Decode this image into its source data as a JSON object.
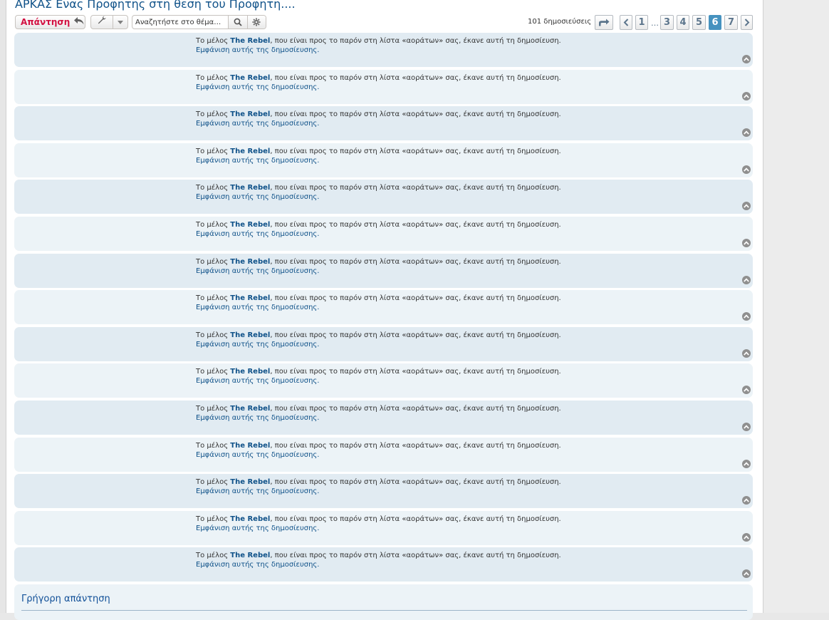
{
  "topic": {
    "title": "ΑΡΚΑΣ Ενας Προφητης στη θεση του Προφητη...."
  },
  "actions": {
    "reply_label": "Απάντηση",
    "reply_icon": "reply-arrow-icon",
    "tools_icon": "wrench-icon",
    "search_placeholder": "Αναζητήστε στο θέμα…",
    "search_icon": "search-icon",
    "advanced_search_icon": "gear-icon"
  },
  "pagination": {
    "post_count": "101 δημοσιεύσεις",
    "pages": [
      "1",
      "3",
      "4",
      "5",
      "6",
      "7"
    ],
    "ellipsis": "…",
    "current_page": "6"
  },
  "posts": [
    {
      "member_prefix": "Το μέλος",
      "member": "The Rebel",
      "member_suffix": ", που είναι προς το παρόν στη λίστα «αοράτων» σας, έκανε αυτή τη δημοσίευση.",
      "show_link": "Εμφάνιση αυτής της δημοσίευσης."
    },
    {
      "member_prefix": "Το μέλος",
      "member": "The Rebel",
      "member_suffix": ", που είναι προς το παρόν στη λίστα «αοράτων» σας, έκανε αυτή τη δημοσίευση.",
      "show_link": "Εμφάνιση αυτής της δημοσίευσης."
    },
    {
      "member_prefix": "Το μέλος",
      "member": "The Rebel",
      "member_suffix": ", που είναι προς το παρόν στη λίστα «αοράτων» σας, έκανε αυτή τη δημοσίευση.",
      "show_link": "Εμφάνιση αυτής της δημοσίευσης."
    },
    {
      "member_prefix": "Το μέλος",
      "member": "The Rebel",
      "member_suffix": ", που είναι προς το παρόν στη λίστα «αοράτων» σας, έκανε αυτή τη δημοσίευση.",
      "show_link": "Εμφάνιση αυτής της δημοσίευσης."
    },
    {
      "member_prefix": "Το μέλος",
      "member": "The Rebel",
      "member_suffix": ", που είναι προς το παρόν στη λίστα «αοράτων» σας, έκανε αυτή τη δημοσίευση.",
      "show_link": "Εμφάνιση αυτής της δημοσίευσης."
    },
    {
      "member_prefix": "Το μέλος",
      "member": "The Rebel",
      "member_suffix": ", που είναι προς το παρόν στη λίστα «αοράτων» σας, έκανε αυτή τη δημοσίευση.",
      "show_link": "Εμφάνιση αυτής της δημοσίευσης."
    },
    {
      "member_prefix": "Το μέλος",
      "member": "The Rebel",
      "member_suffix": ", που είναι προς το παρόν στη λίστα «αοράτων» σας, έκανε αυτή τη δημοσίευση.",
      "show_link": "Εμφάνιση αυτής της δημοσίευσης."
    },
    {
      "member_prefix": "Το μέλος",
      "member": "The Rebel",
      "member_suffix": ", που είναι προς το παρόν στη λίστα «αοράτων» σας, έκανε αυτή τη δημοσίευση.",
      "show_link": "Εμφάνιση αυτής της δημοσίευσης."
    },
    {
      "member_prefix": "Το μέλος",
      "member": "The Rebel",
      "member_suffix": ", που είναι προς το παρόν στη λίστα «αοράτων» σας, έκανε αυτή τη δημοσίευση.",
      "show_link": "Εμφάνιση αυτής της δημοσίευσης."
    },
    {
      "member_prefix": "Το μέλος",
      "member": "The Rebel",
      "member_suffix": ", που είναι προς το παρόν στη λίστα «αοράτων» σας, έκανε αυτή τη δημοσίευση.",
      "show_link": "Εμφάνιση αυτής της δημοσίευσης."
    },
    {
      "member_prefix": "Το μέλος",
      "member": "The Rebel",
      "member_suffix": ", που είναι προς το παρόν στη λίστα «αοράτων» σας, έκανε αυτή τη δημοσίευση.",
      "show_link": "Εμφάνιση αυτής της δημοσίευσης."
    },
    {
      "member_prefix": "Το μέλος",
      "member": "The Rebel",
      "member_suffix": ", που είναι προς το παρόν στη λίστα «αοράτων» σας, έκανε αυτή τη δημοσίευση.",
      "show_link": "Εμφάνιση αυτής της δημοσίευσης."
    },
    {
      "member_prefix": "Το μέλος",
      "member": "The Rebel",
      "member_suffix": ", που είναι προς το παρόν στη λίστα «αοράτων» σας, έκανε αυτή τη δημοσίευση.",
      "show_link": "Εμφάνιση αυτής της δημοσίευσης."
    },
    {
      "member_prefix": "Το μέλος",
      "member": "The Rebel",
      "member_suffix": ", που είναι προς το παρόν στη λίστα «αοράτων» σας, έκανε αυτή τη δημοσίευση.",
      "show_link": "Εμφάνιση αυτής της δημοσίευσης."
    },
    {
      "member_prefix": "Το μέλος",
      "member": "The Rebel",
      "member_suffix": ", που είναι προς το παρόν στη λίστα «αοράτων» σας, έκανε αυτή τη δημοσίευση.",
      "show_link": "Εμφάνιση αυτής της δημοσίευσης."
    }
  ],
  "post_top_icon": "arrow-up-circle-icon",
  "quick_reply": {
    "title": "Γρήγορη απάντηση"
  },
  "colors": {
    "link": "#105289",
    "reply_accent": "#d31141",
    "post_bg_dark": "#e1ebf2",
    "post_bg_light": "#ecf3f7",
    "active_page": "#4692bf"
  }
}
